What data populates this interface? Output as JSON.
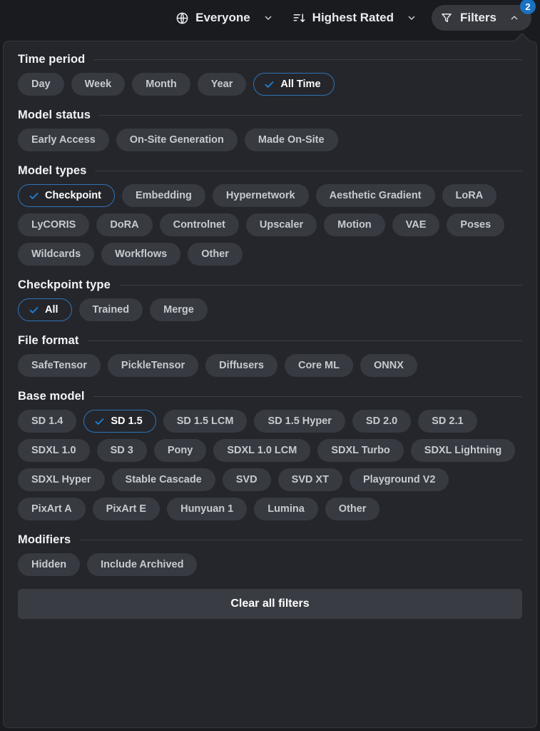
{
  "topbar": {
    "audience": {
      "label": "Everyone",
      "icon": "globe-icon",
      "caret": "chevron-down-icon"
    },
    "sort": {
      "label": "Highest Rated",
      "icon": "sort-descending-icon",
      "caret": "chevron-down-icon"
    },
    "filters": {
      "label": "Filters",
      "icon": "funnel-icon",
      "caret": "chevron-up-icon",
      "badge": "2"
    }
  },
  "colors": {
    "accent": "#1c7ed6",
    "selected_border": "#2d74b8",
    "panel_bg": "#25262b",
    "page_bg": "#1a1b1e",
    "chip_bg": "#373a40",
    "badge_bg": "#1971c2"
  },
  "panel": {
    "sections": [
      {
        "title": "Time period",
        "chips": [
          {
            "label": "Day",
            "selected": false
          },
          {
            "label": "Week",
            "selected": false
          },
          {
            "label": "Month",
            "selected": false
          },
          {
            "label": "Year",
            "selected": false
          },
          {
            "label": "All Time",
            "selected": true
          }
        ]
      },
      {
        "title": "Model status",
        "chips": [
          {
            "label": "Early Access",
            "selected": false
          },
          {
            "label": "On-Site Generation",
            "selected": false
          },
          {
            "label": "Made On-Site",
            "selected": false
          }
        ]
      },
      {
        "title": "Model types",
        "chips": [
          {
            "label": "Checkpoint",
            "selected": true
          },
          {
            "label": "Embedding",
            "selected": false
          },
          {
            "label": "Hypernetwork",
            "selected": false
          },
          {
            "label": "Aesthetic Gradient",
            "selected": false
          },
          {
            "label": "LoRA",
            "selected": false
          },
          {
            "label": "LyCORIS",
            "selected": false
          },
          {
            "label": "DoRA",
            "selected": false
          },
          {
            "label": "Controlnet",
            "selected": false
          },
          {
            "label": "Upscaler",
            "selected": false
          },
          {
            "label": "Motion",
            "selected": false
          },
          {
            "label": "VAE",
            "selected": false
          },
          {
            "label": "Poses",
            "selected": false
          },
          {
            "label": "Wildcards",
            "selected": false
          },
          {
            "label": "Workflows",
            "selected": false
          },
          {
            "label": "Other",
            "selected": false
          }
        ]
      },
      {
        "title": "Checkpoint type",
        "chips": [
          {
            "label": "All",
            "selected": true
          },
          {
            "label": "Trained",
            "selected": false
          },
          {
            "label": "Merge",
            "selected": false
          }
        ]
      },
      {
        "title": "File format",
        "chips": [
          {
            "label": "SafeTensor",
            "selected": false
          },
          {
            "label": "PickleTensor",
            "selected": false
          },
          {
            "label": "Diffusers",
            "selected": false
          },
          {
            "label": "Core ML",
            "selected": false
          },
          {
            "label": "ONNX",
            "selected": false
          }
        ]
      },
      {
        "title": "Base model",
        "chips": [
          {
            "label": "SD 1.4",
            "selected": false
          },
          {
            "label": "SD 1.5",
            "selected": true
          },
          {
            "label": "SD 1.5 LCM",
            "selected": false
          },
          {
            "label": "SD 1.5 Hyper",
            "selected": false
          },
          {
            "label": "SD 2.0",
            "selected": false
          },
          {
            "label": "SD 2.1",
            "selected": false
          },
          {
            "label": "SDXL 1.0",
            "selected": false
          },
          {
            "label": "SD 3",
            "selected": false
          },
          {
            "label": "Pony",
            "selected": false
          },
          {
            "label": "SDXL 1.0 LCM",
            "selected": false
          },
          {
            "label": "SDXL Turbo",
            "selected": false
          },
          {
            "label": "SDXL Lightning",
            "selected": false
          },
          {
            "label": "SDXL Hyper",
            "selected": false
          },
          {
            "label": "Stable Cascade",
            "selected": false
          },
          {
            "label": "SVD",
            "selected": false
          },
          {
            "label": "SVD XT",
            "selected": false
          },
          {
            "label": "Playground V2",
            "selected": false
          },
          {
            "label": "PixArt A",
            "selected": false
          },
          {
            "label": "PixArt E",
            "selected": false
          },
          {
            "label": "Hunyuan 1",
            "selected": false
          },
          {
            "label": "Lumina",
            "selected": false
          },
          {
            "label": "Other",
            "selected": false
          }
        ]
      },
      {
        "title": "Modifiers",
        "chips": [
          {
            "label": "Hidden",
            "selected": false
          },
          {
            "label": "Include Archived",
            "selected": false
          }
        ]
      }
    ],
    "clear_button": {
      "label": "Clear all filters"
    }
  }
}
